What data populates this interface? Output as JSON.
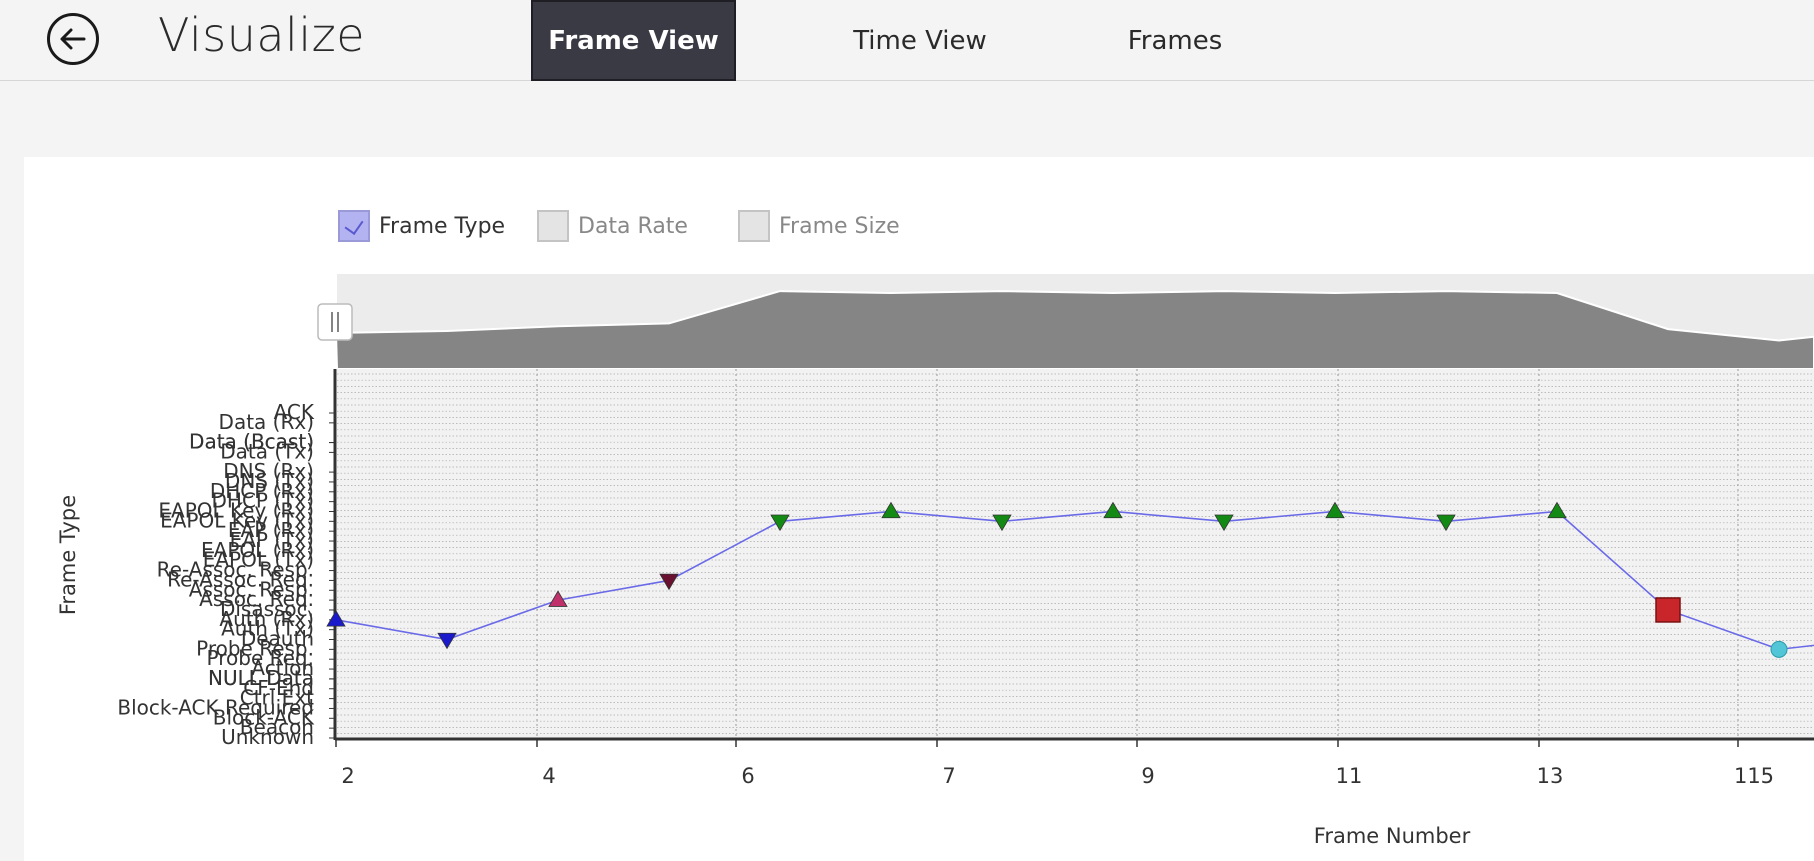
{
  "header": {
    "title": "Visualize",
    "tabs": [
      {
        "label": "Frame View",
        "active": true
      },
      {
        "label": "Time View",
        "active": false
      },
      {
        "label": "Frames",
        "active": false
      }
    ]
  },
  "toggles": [
    {
      "label": "Frame Type",
      "checked": true
    },
    {
      "label": "Data Rate",
      "checked": false
    },
    {
      "label": "Frame Size",
      "checked": false
    }
  ],
  "colors": {
    "active_tab": "#3a3a44",
    "line": "#6a6ae8",
    "checkbox_checked": "#b3b3f2",
    "overview_area": "#858585"
  },
  "chart_data": {
    "type": "line",
    "ylabel": "Frame Type",
    "xlabel": "Frame Number",
    "x_tick_labels": [
      "2",
      "4",
      "6",
      "7",
      "9",
      "11",
      "13",
      "115"
    ],
    "y_categories": [
      "Unknown",
      "Beacon",
      "Block-ACK",
      "Block-ACK Required",
      "Ctrl Ext",
      "CF-End",
      "NULL Data",
      "Action",
      "Probe Req.",
      "Probe Resp.",
      "Deauth",
      "Auth (Tx)",
      "Auth (Rx)",
      "Disassoc.",
      "Assoc. Req.",
      "Assoc. Resp.",
      "Re-Assoc. Req.",
      "Re-Assoc. Resp.",
      "EAPOL (Tx)",
      "EAPOL (Rx)",
      "EAP (Tx)",
      "EAP (Rx)",
      "EAPOL Key (Tx)",
      "EAPOL Key (Rx)",
      "DHCP (Tx)",
      "DHCP (Rx)",
      "DNS (Tx)",
      "DNS (Rx)",
      "NULL Data",
      "Data (Tx)",
      "Data (Bcast)",
      "Data (Bcast)",
      "Data (Rx)",
      "ACK"
    ],
    "series": [
      {
        "points": [
          {
            "x": "2",
            "y": "Auth (Rx)",
            "marker": "triangle-up",
            "color": "#1a1acc"
          },
          {
            "x": "3",
            "y": "Deauth",
            "marker": "triangle-down",
            "color": "#1a1acc"
          },
          {
            "x": "4",
            "y": "Assoc. Req.",
            "marker": "triangle-up",
            "color": "#c0306a"
          },
          {
            "x": "5",
            "y": "Re-Assoc. Req.",
            "marker": "triangle-down",
            "color": "#6a1030"
          },
          {
            "x": "6",
            "y": "EAPOL Key (Tx)",
            "marker": "triangle-down",
            "color": "#138a13"
          },
          {
            "x": "7",
            "y": "EAPOL Key (Rx)",
            "marker": "triangle-up",
            "color": "#138a13"
          },
          {
            "x": "8",
            "y": "EAPOL Key (Tx)",
            "marker": "triangle-down",
            "color": "#138a13"
          },
          {
            "x": "9",
            "y": "EAPOL Key (Rx)",
            "marker": "triangle-up",
            "color": "#138a13"
          },
          {
            "x": "10",
            "y": "EAPOL Key (Tx)",
            "marker": "triangle-down",
            "color": "#138a13"
          },
          {
            "x": "11",
            "y": "EAPOL Key (Rx)",
            "marker": "triangle-up",
            "color": "#138a13"
          },
          {
            "x": "12",
            "y": "EAPOL Key (Tx)",
            "marker": "triangle-down",
            "color": "#138a13"
          },
          {
            "x": "13",
            "y": "EAPOL Key (Rx)",
            "marker": "triangle-up",
            "color": "#138a13"
          },
          {
            "x": "14",
            "y": "Disassoc.",
            "marker": "square",
            "color": "#c8262a"
          },
          {
            "x": "15",
            "y": "Probe Resp.",
            "marker": "circle",
            "color": "#52c6d6"
          }
        ]
      }
    ],
    "overview_values": [
      0.38,
      0.4,
      0.45,
      0.48,
      0.82,
      0.8,
      0.82,
      0.8,
      0.82,
      0.8,
      0.82,
      0.8,
      0.42,
      0.3
    ],
    "grid": true
  }
}
